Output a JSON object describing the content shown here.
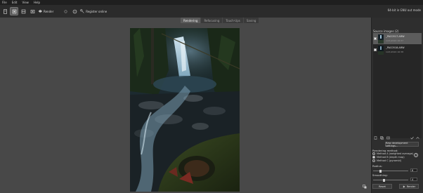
{
  "menu": [
    "File",
    "Edit",
    "View",
    "Help"
  ],
  "toolbar": {
    "render_label": "Render",
    "register_label": "Register online",
    "mode_text": "64-bit in GNU out mode"
  },
  "tabs": [
    {
      "label": "Rendering",
      "active": true
    },
    {
      "label": "Refocusing",
      "active": false
    },
    {
      "label": "Touch-Ups",
      "active": false
    },
    {
      "label": "Saving",
      "active": false
    }
  ],
  "sidebar": {
    "source_title": "Source images (2)",
    "images": [
      {
        "name": "_PAC0517.ARW",
        "date": "1/21/2022 16:37",
        "selected": true
      },
      {
        "name": "_PAC0518.ARW",
        "date": "1/21/2022 16:38",
        "selected": false
      }
    ],
    "raw_button": "Raw development settings...",
    "rendering_method_label": "Rendering method:",
    "methods": [
      {
        "label": "Method A (weighted average)",
        "selected": false
      },
      {
        "label": "Method B (depth map)",
        "selected": true
      },
      {
        "label": "Method C (pyramid)",
        "selected": false
      }
    ],
    "radius_label": "Radius:",
    "radius_value": "8",
    "smoothing_label": "Smoothing:",
    "smoothing_value": "4",
    "reset_label": "Reset",
    "render_label": "Render"
  },
  "slider_levels": {
    "radius": 0.2,
    "smoothing": 0.3
  }
}
